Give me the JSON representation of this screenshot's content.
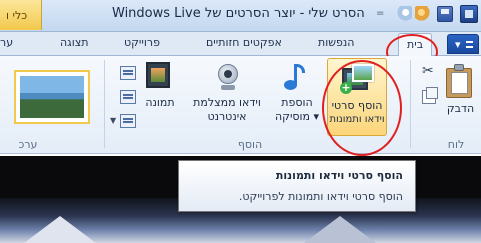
{
  "window": {
    "title": "הסרט שלי - יוצר הסרטים של Windows Live",
    "context_tab": "כלי ו",
    "qat_separator": "="
  },
  "tabs": [
    {
      "label": "בית",
      "active": true
    },
    {
      "label": "הנפשות",
      "active": false
    },
    {
      "label": "אפקטים חזותיים",
      "active": false
    },
    {
      "label": "פרוייקט",
      "active": false
    },
    {
      "label": "תצוגה",
      "active": false
    },
    {
      "label": "ער",
      "active": false
    }
  ],
  "ribbon": {
    "clipboard": {
      "paste_label": "הדבק",
      "group_label": "לוח"
    },
    "add_group": {
      "add_media_line1": "הוסף סרטי",
      "add_media_line2": "וידאו ותמונות",
      "add_music_line1": "הוספת",
      "add_music_line2": "מוסיקה ▾",
      "webcam_line1": "וידאו ממצלמת",
      "webcam_line2": "אינטרנט",
      "snapshot_label": "תמונה",
      "group_label": "הוסף"
    },
    "themes": {
      "group_label": "ערכ"
    }
  },
  "tooltip": {
    "title": "הוסף סרטי וידאו ותמונות",
    "description": "הוסף סרטי וידאו ותמונות לפרוייקט."
  },
  "annotations": {
    "circle_color": "#e02020"
  }
}
